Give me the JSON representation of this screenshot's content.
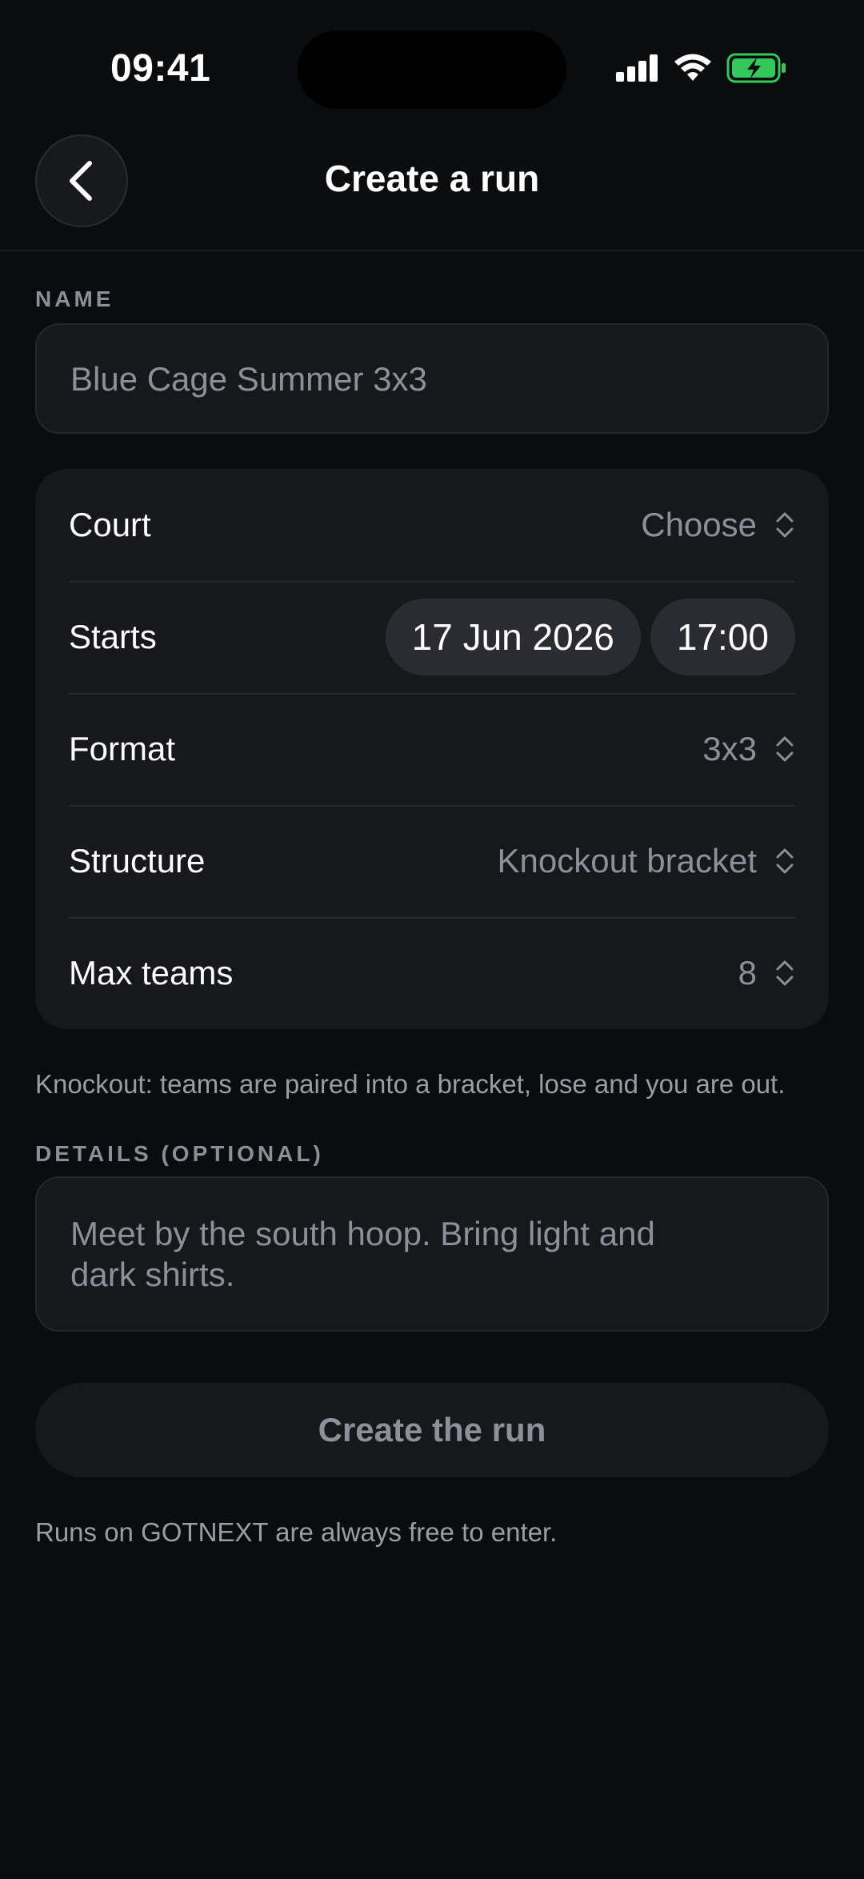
{
  "status_bar": {
    "time": "09:41"
  },
  "header": {
    "title": "Create a run",
    "back_icon": "chevron-left-icon"
  },
  "name_section": {
    "label": "NAME",
    "placeholder": "Blue Cage Summer 3x3"
  },
  "settings": {
    "court": {
      "label": "Court",
      "value": "Choose"
    },
    "starts": {
      "label": "Starts",
      "date": "17 Jun 2026",
      "time": "17:00"
    },
    "format": {
      "label": "Format",
      "value": "3x3"
    },
    "structure": {
      "label": "Structure",
      "value": "Knockout bracket"
    },
    "max_teams": {
      "label": "Max teams",
      "value": "8"
    }
  },
  "structure_help": "Knockout: teams are paired into a bracket, lose and you are out.",
  "details_section": {
    "label": "DETAILS (OPTIONAL)",
    "placeholder": "Meet by the south hoop. Bring light and dark shirts."
  },
  "create_button_label": "Create the run",
  "footer_note": "Runs on GOTNEXT are always free to enter.",
  "colors": {
    "background": "#0b0c0e",
    "card": "#17181c",
    "muted_text": "#8d9099",
    "battery_green": "#34c759"
  }
}
